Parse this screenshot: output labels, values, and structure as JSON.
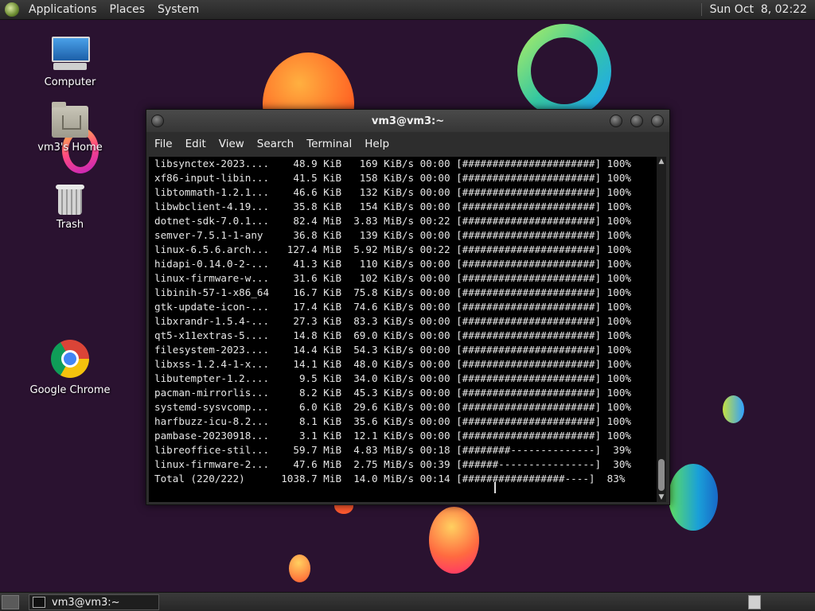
{
  "top_panel": {
    "menus": [
      "Applications",
      "Places",
      "System"
    ],
    "clock": "Sun Oct  8, 02:22"
  },
  "desktop_icons": {
    "computer": "Computer",
    "home": "vm3's Home",
    "trash": "Trash",
    "chrome": "Google Chrome"
  },
  "window": {
    "title": "vm3@vm3:~",
    "menu": [
      "File",
      "Edit",
      "View",
      "Search",
      "Terminal",
      "Help"
    ]
  },
  "terminal": {
    "lines": [
      "libsynctex-2023....    48.9 KiB   169 KiB/s 00:00 [######################] 100%",
      "xf86-input-libin...    41.5 KiB   158 KiB/s 00:00 [######################] 100%",
      "libtommath-1.2.1...    46.6 KiB   132 KiB/s 00:00 [######################] 100%",
      "libwbclient-4.19...    35.8 KiB   154 KiB/s 00:00 [######################] 100%",
      "dotnet-sdk-7.0.1...    82.4 MiB  3.83 MiB/s 00:22 [######################] 100%",
      "semver-7.5.1-1-any     36.8 KiB   139 KiB/s 00:00 [######################] 100%",
      "linux-6.5.6.arch...   127.4 MiB  5.92 MiB/s 00:22 [######################] 100%",
      "hidapi-0.14.0-2-...    41.3 KiB   110 KiB/s 00:00 [######################] 100%",
      "linux-firmware-w...    31.6 KiB   102 KiB/s 00:00 [######################] 100%",
      "libinih-57-1-x86_64    16.7 KiB  75.8 KiB/s 00:00 [######################] 100%",
      "gtk-update-icon-...    17.4 KiB  74.6 KiB/s 00:00 [######################] 100%",
      "libxrandr-1.5.4-...    27.3 KiB  83.3 KiB/s 00:00 [######################] 100%",
      "qt5-x11extras-5....    14.8 KiB  69.0 KiB/s 00:00 [######################] 100%",
      "filesystem-2023....    14.4 KiB  54.3 KiB/s 00:00 [######################] 100%",
      "libxss-1.2.4-1-x...    14.1 KiB  48.0 KiB/s 00:00 [######################] 100%",
      "libutempter-1.2....     9.5 KiB  34.0 KiB/s 00:00 [######################] 100%",
      "pacman-mirrorlis...     8.2 KiB  45.3 KiB/s 00:00 [######################] 100%",
      "systemd-sysvcomp...     6.0 KiB  29.6 KiB/s 00:00 [######################] 100%",
      "harfbuzz-icu-8.2...     8.1 KiB  35.6 KiB/s 00:00 [######################] 100%",
      "pambase-20230918...     3.1 KiB  12.1 KiB/s 00:00 [######################] 100%",
      "libreoffice-stil...    59.7 MiB  4.83 MiB/s 00:18 [########--------------]  39%",
      "linux-firmware-2...    47.6 MiB  2.75 MiB/s 00:39 [######----------------]  30%",
      "Total (220/222)      1038.7 MiB  14.0 MiB/s 00:14 [#################----]  83%"
    ]
  },
  "taskbar": {
    "task_label": "vm3@vm3:~"
  },
  "colors": {
    "desktop_bg": "#2a1230",
    "terminal_bg": "#000000",
    "terminal_fg": "#e6e6e6",
    "panel_bg": "#2e2e2e"
  }
}
